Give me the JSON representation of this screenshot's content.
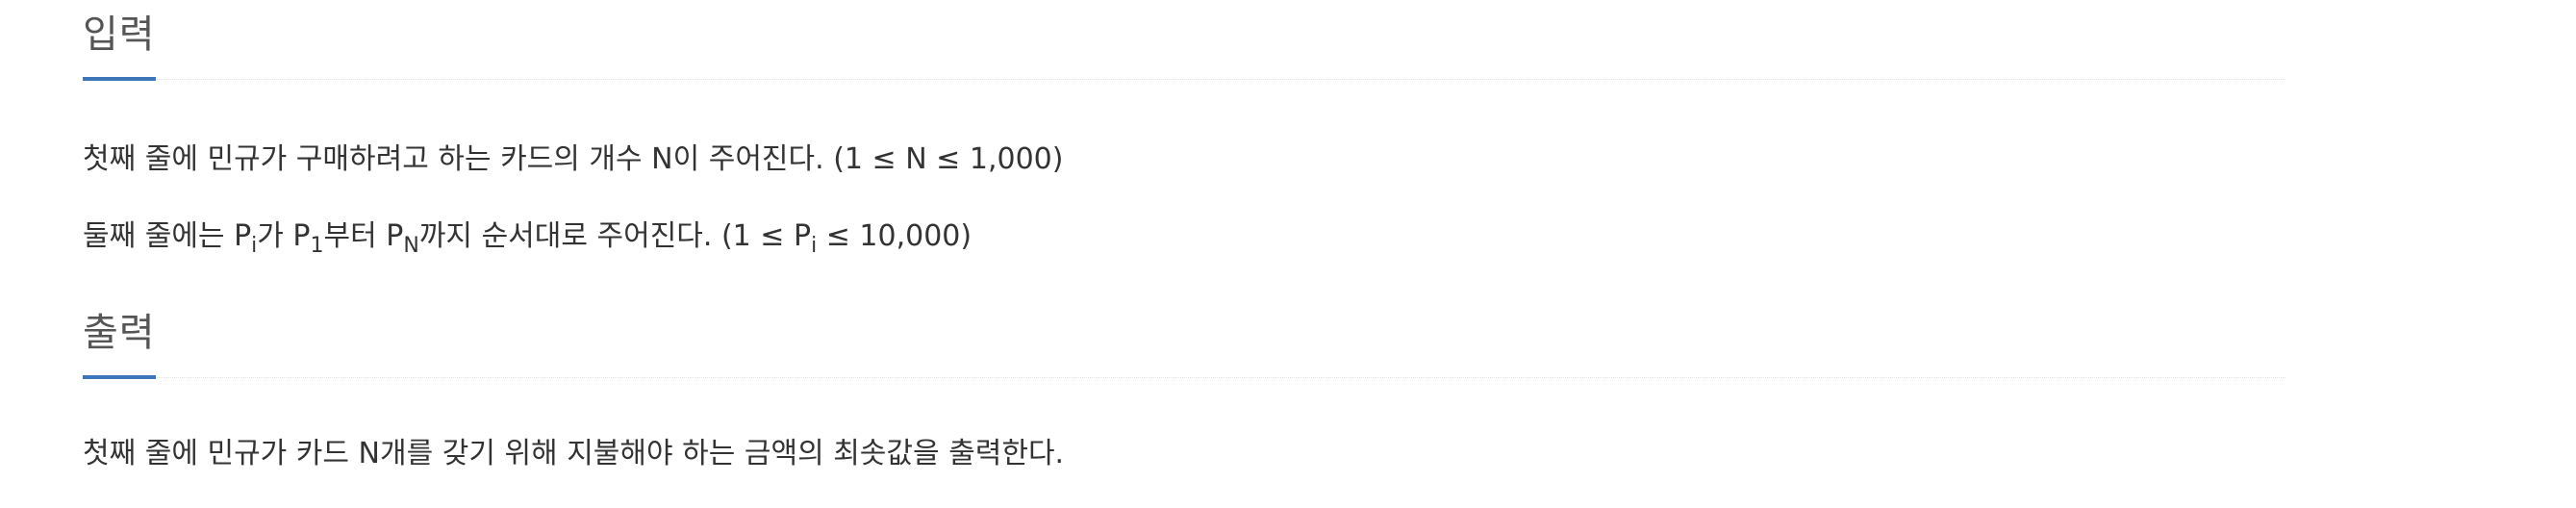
{
  "input_section": {
    "title": "입력",
    "line1": "첫째 줄에 민규가 구매하려고 하는 카드의 개수 N이 주어진다. (1 ≤ N ≤ 1,000)",
    "line2": {
      "part1": "둘째 줄에는 P",
      "sub1": "i",
      "part2": "가 P",
      "sub2": "1",
      "part3": "부터 P",
      "sub3": "N",
      "part4": "까지 순서대로 주어진다. (1 ≤ P",
      "sub4": "i",
      "part5": " ≤ 10,000)"
    }
  },
  "output_section": {
    "title": "출력",
    "line1": "첫째 줄에 민규가 카드 N개를 갖기 위해 지불해야 하는 금액의 최솟값을 출력한다."
  },
  "colors": {
    "accent": "#3c76b8",
    "title_text": "#555555",
    "body_text": "#333333",
    "divider": "#e3e3e3"
  }
}
